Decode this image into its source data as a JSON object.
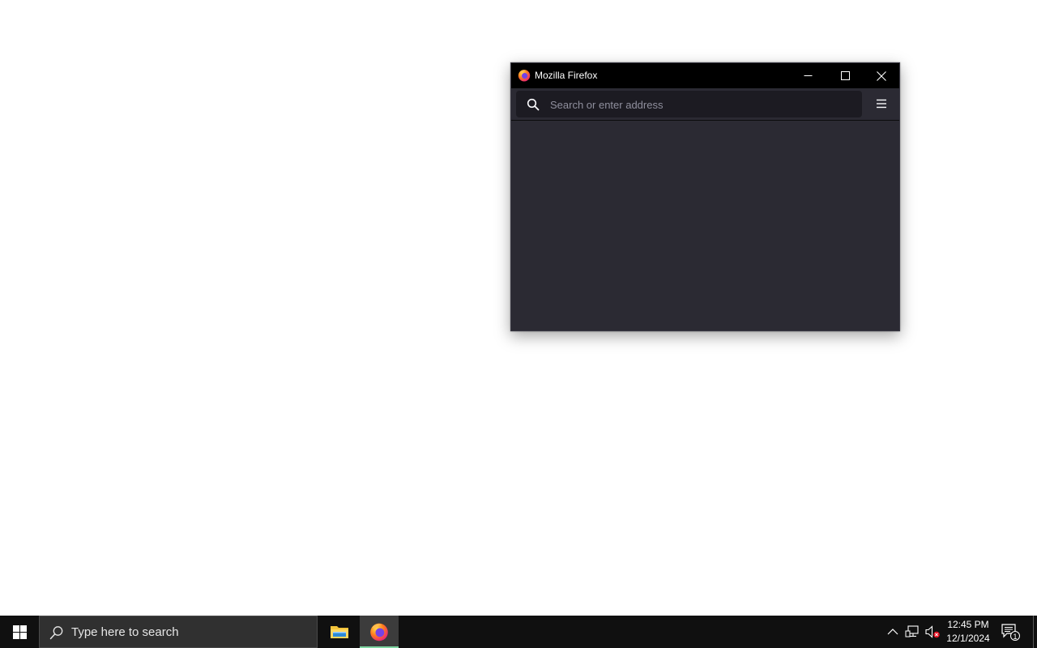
{
  "firefox_window": {
    "title": "Mozilla Firefox",
    "address_bar": {
      "value": "",
      "placeholder": "Search or enter address"
    },
    "buttons": {
      "minimize": "minimize",
      "maximize": "maximize",
      "close": "close"
    }
  },
  "taskbar": {
    "search_placeholder": "Type here to search",
    "pinned_apps": [
      "File Explorer",
      "Firefox"
    ],
    "clock": {
      "time": "12:45 PM",
      "date": "12/1/2024"
    },
    "notification_count": "1"
  },
  "colors": {
    "firefox_toolbar": "#2b2a33",
    "urlbar": "#1c1b22",
    "taskbar": "#101010",
    "active_app_indicator": "#7fd6a2"
  }
}
